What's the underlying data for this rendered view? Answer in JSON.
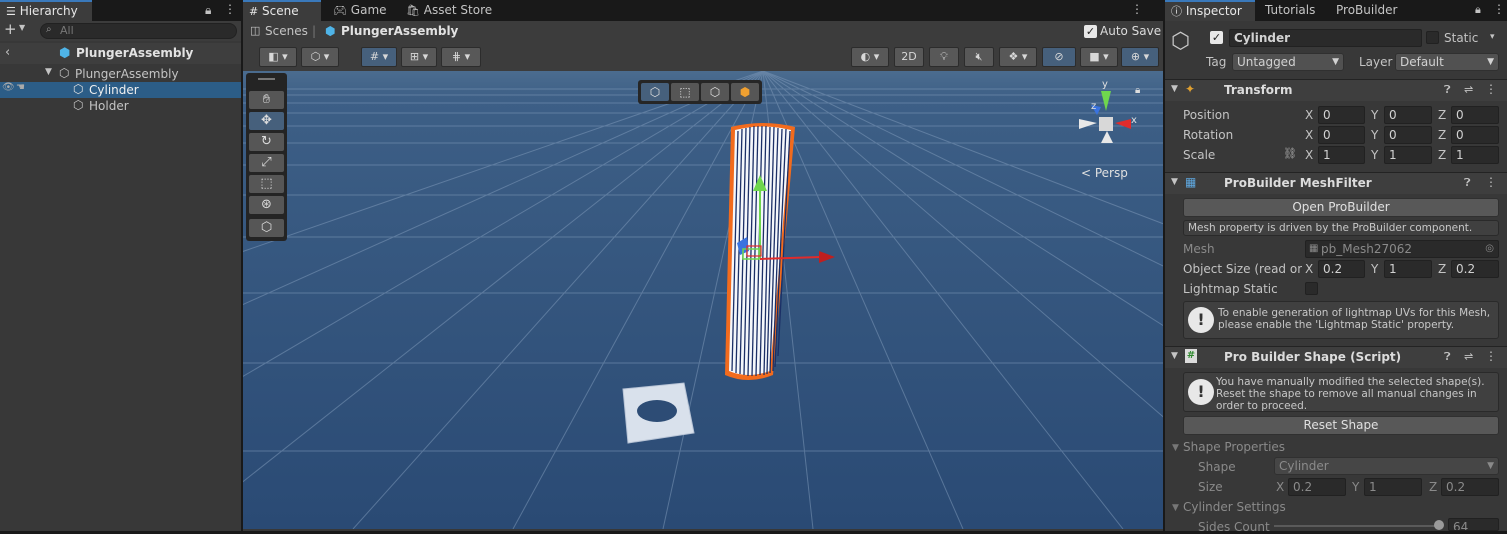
{
  "hierarchy": {
    "tab_label": "Hierarchy",
    "search_placeholder": "All",
    "scene_title": "PlungerAssembly",
    "root_object": "PlungerAssembly",
    "children": [
      "Cylinder",
      "Holder"
    ]
  },
  "scene_tabs": [
    "Scene",
    "Game",
    "Asset Store"
  ],
  "breadcrumb": {
    "root": "Scenes",
    "current": "PlungerAssembly"
  },
  "auto_save_label": "Auto Save",
  "scene_toolbar": {
    "two_d_label": "2D"
  },
  "persp_label": "< Persp",
  "gizmo_axes": {
    "x": "x",
    "y": "y",
    "z": "z"
  },
  "inspector": {
    "tabs": [
      "Inspector",
      "Tutorials",
      "ProBuilder"
    ],
    "object_name": "Cylinder",
    "static_label": "Static",
    "tag_label": "Tag",
    "tag_value": "Untagged",
    "layer_label": "Layer",
    "layer_value": "Default",
    "transform": {
      "title": "Transform",
      "position_label": "Position",
      "rotation_label": "Rotation",
      "scale_label": "Scale",
      "position": [
        "0",
        "0",
        "0"
      ],
      "rotation": [
        "0",
        "0",
        "0"
      ],
      "scale": [
        "1",
        "1",
        "1"
      ]
    },
    "meshfilter": {
      "title": "ProBuilder MeshFilter",
      "open_button": "Open ProBuilder",
      "driven_note": "Mesh property is driven by the ProBuilder component.",
      "mesh_label": "Mesh",
      "mesh_value": "pb_Mesh27062",
      "object_size_label": "Object Size (read only)",
      "object_size": [
        "0.2",
        "1",
        "0.2"
      ],
      "lightmap_label": "Lightmap Static",
      "lightmap_help": "To enable generation of lightmap UVs for this Mesh, please enable the 'Lightmap Static' property."
    },
    "shape": {
      "title": "Pro Builder Shape (Script)",
      "warning": "You have manually modified the selected shape(s). Reset the shape to remove all manual changes in order to proceed.",
      "reset_button": "Reset Shape",
      "shape_properties_label": "Shape Properties",
      "shape_label": "Shape",
      "shape_value": "Cylinder",
      "size_label": "Size",
      "size": [
        "0.2",
        "1",
        "0.2"
      ],
      "cylinder_settings_label": "Cylinder Settings",
      "sides_count_label": "Sides Count",
      "sides_count": "64"
    },
    "axis_labels": [
      "X",
      "Y",
      "Z"
    ]
  },
  "colors": {
    "accent": "#3a79bb",
    "selection": "#2c5d87",
    "scene_bg": "#2c4a73",
    "outline": "#f26b1d"
  }
}
